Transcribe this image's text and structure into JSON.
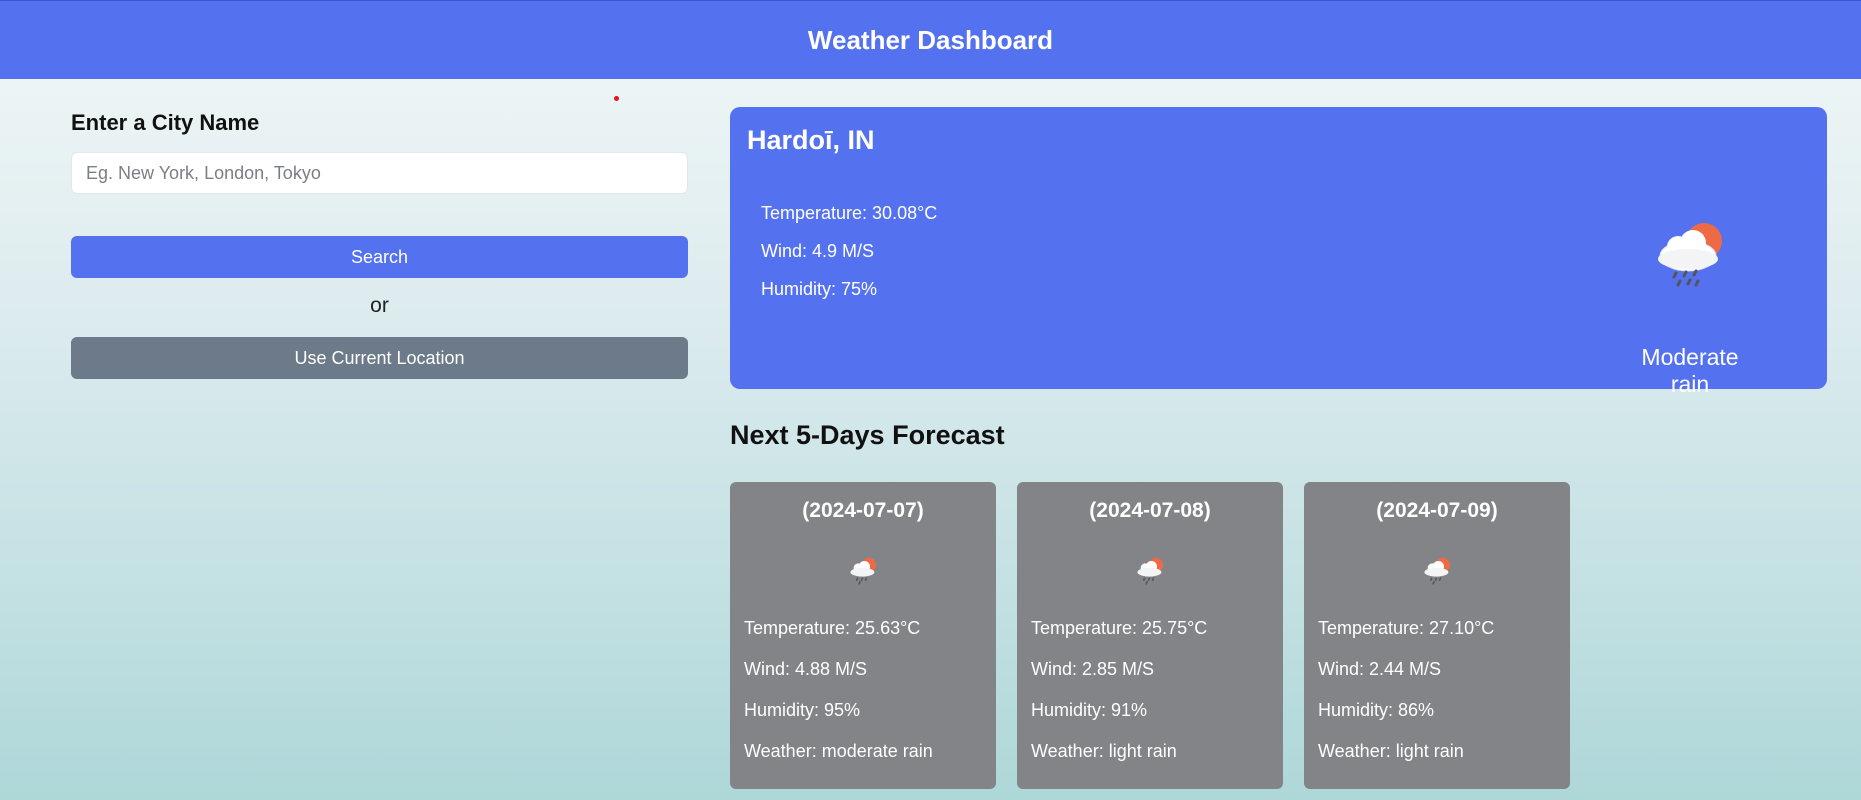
{
  "header": {
    "title": "Weather Dashboard"
  },
  "search": {
    "label": "Enter a City Name",
    "placeholder": "Eg. New York, London, Tokyo",
    "value": "",
    "search_button": "Search",
    "or_text": "or",
    "location_button": "Use Current Location"
  },
  "current": {
    "city": "Hardoī, IN",
    "temperature": "Temperature: 30.08°C",
    "wind": "Wind: 4.9 M/S",
    "humidity": "Humidity: 75%",
    "description": "Moderate rain",
    "icon": "rain-cloud-sun-icon"
  },
  "forecast": {
    "title": "Next 5-Days Forecast",
    "days": [
      {
        "date": "(2024-07-07)",
        "temperature": "Temperature: 25.63°C",
        "wind": "Wind: 4.88 M/S",
        "humidity": "Humidity: 95%",
        "weather": "Weather: moderate rain",
        "icon": "rain-cloud-sun-icon"
      },
      {
        "date": "(2024-07-08)",
        "temperature": "Temperature: 25.75°C",
        "wind": "Wind: 2.85 M/S",
        "humidity": "Humidity: 91%",
        "weather": "Weather: light rain",
        "icon": "rain-cloud-sun-icon"
      },
      {
        "date": "(2024-07-09)",
        "temperature": "Temperature: 27.10°C",
        "wind": "Wind: 2.44 M/S",
        "humidity": "Humidity: 86%",
        "weather": "Weather: light rain",
        "icon": "rain-cloud-sun-icon"
      }
    ]
  },
  "colors": {
    "accent": "#5472ef",
    "secondary_button": "#6c7a89",
    "card_background": "#828488",
    "sun": "#ee6a47"
  }
}
